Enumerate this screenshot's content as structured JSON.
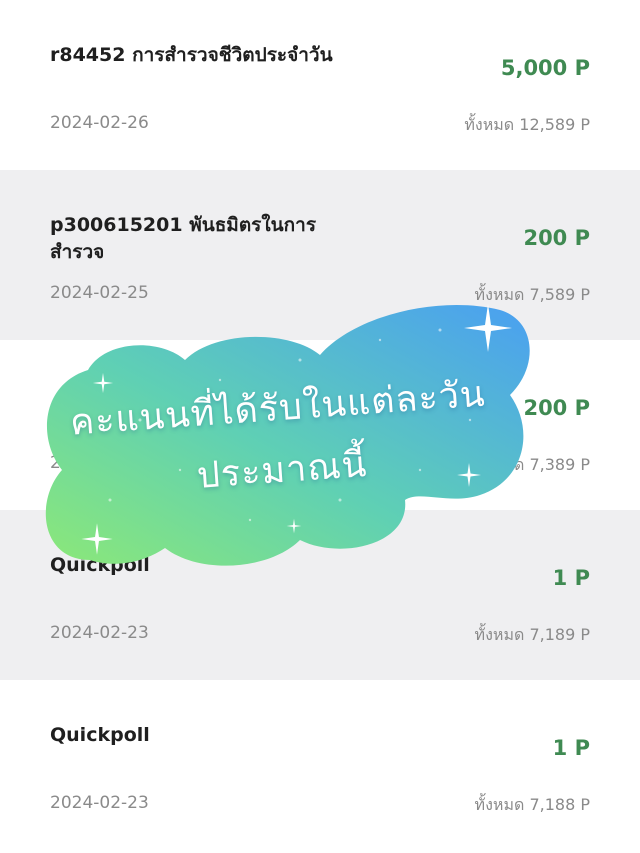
{
  "transactions": [
    {
      "title": "r84452 การสำรวจชีวิตประจำวัน",
      "amount": "5,000 P",
      "date": "2024-02-26",
      "total": "ทั้งหมด 12,589 P"
    },
    {
      "title": "p300615201 พันธมิตรในการสำรวจ",
      "amount": "200 P",
      "date": "2024-02-25",
      "total": "ทั้งหมด 7,589 P"
    },
    {
      "title": "",
      "amount": "200 P",
      "date": "2024-02-24",
      "total": "ทั้งหมด 7,389 P"
    },
    {
      "title": "Quickpoll",
      "amount": "1 P",
      "date": "2024-02-23",
      "total": "ทั้งหมด 7,189 P"
    },
    {
      "title": "Quickpoll",
      "amount": "1 P",
      "date": "2024-02-23",
      "total": "ทั้งหมด 7,188 P"
    }
  ],
  "overlay": {
    "line1": "คะแนนที่ได้รับในแต่ละวัน",
    "line2": "ประมาณนี้"
  },
  "colors": {
    "amount_green": "#3f8a52",
    "row_gray": "#efeff1",
    "cloud_left": "#7ee07a",
    "cloud_right": "#4aa8f0"
  },
  "icons": [
    "sparkle-icon"
  ]
}
